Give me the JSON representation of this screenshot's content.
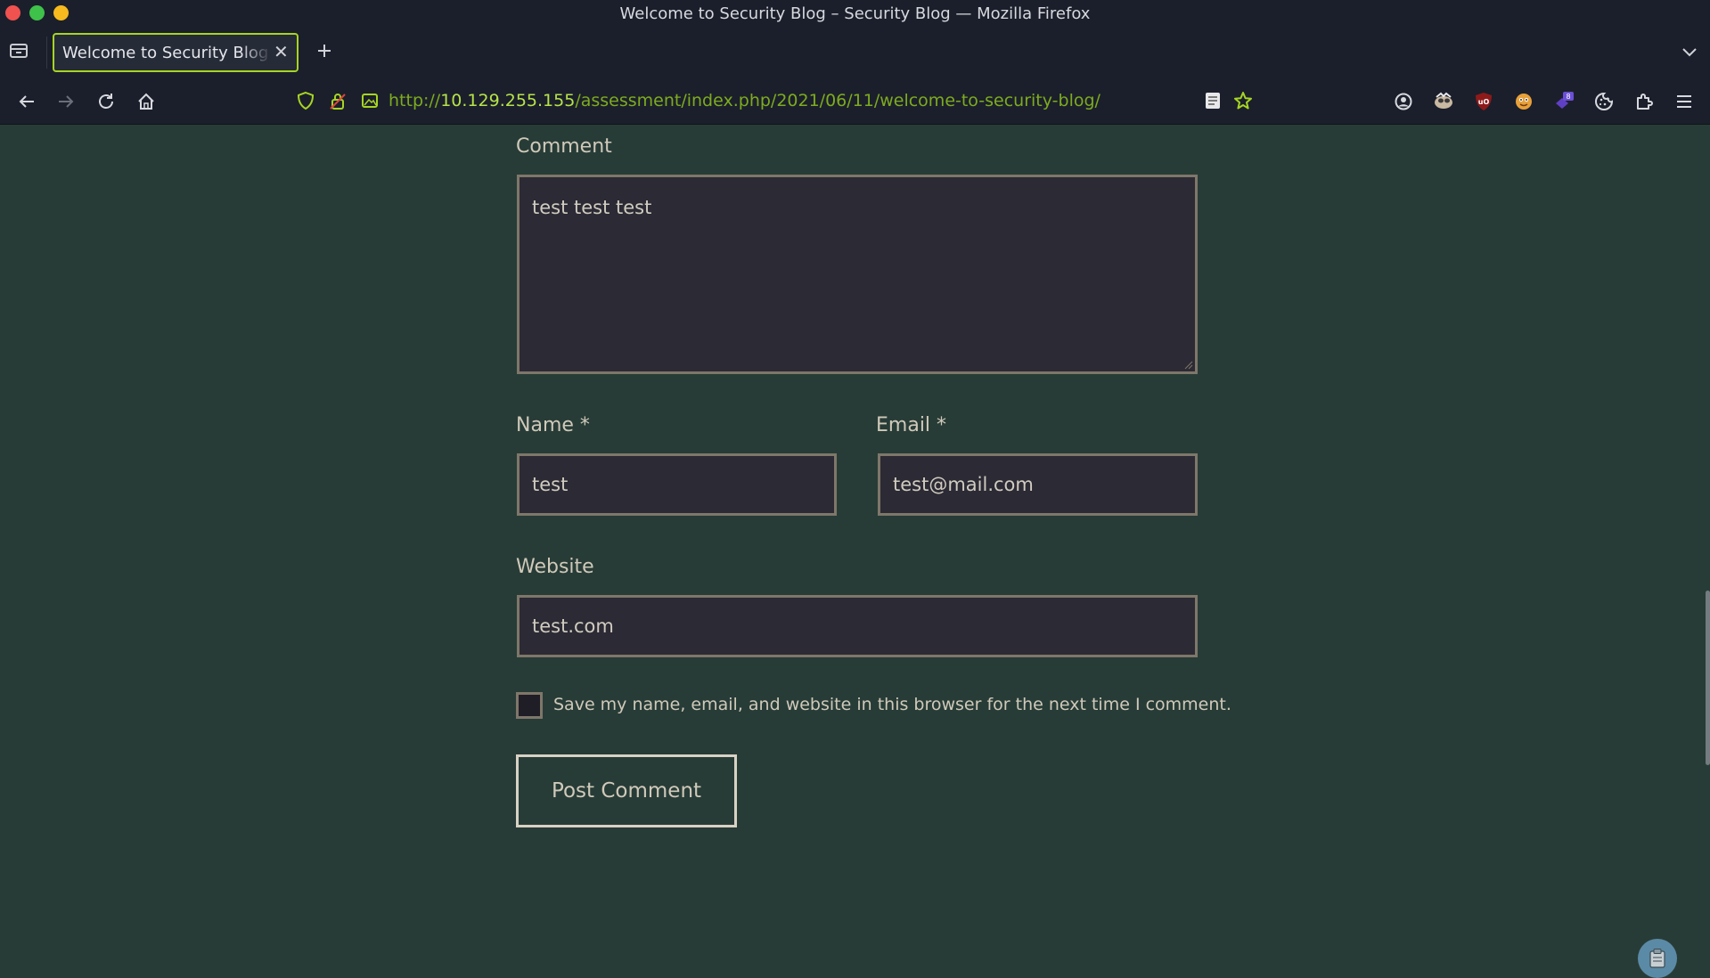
{
  "window": {
    "title": "Welcome to Security Blog – Security Blog — Mozilla Firefox"
  },
  "tabs": [
    {
      "title": "Welcome to Security Blog – Security Blog",
      "active": true
    }
  ],
  "url": {
    "scheme": "http://",
    "host": "10.129.255.155",
    "path": "/assessment/index.php/2021/06/11/welcome-to-security-blog/"
  },
  "toolbar": {
    "extensions": [
      "account-icon",
      "reader-icon",
      "ublock-icon",
      "extension-icon",
      "extension-badge-icon",
      "cookie-icon",
      "extensions-icon",
      "menu-icon"
    ],
    "badge_count": "8"
  },
  "form": {
    "comment_label": "Comment",
    "comment_value": "test test test",
    "name_label": "Name *",
    "name_value": "test",
    "email_label": "Email *",
    "email_value": "test@mail.com",
    "website_label": "Website",
    "website_value": "test.com",
    "save_label": "Save my name, email, and website in this browser for the next time I comment.",
    "save_checked": false,
    "submit_label": "Post Comment"
  },
  "colors": {
    "page_bg": "#283c37",
    "field_bg": "#2c2a34",
    "field_border": "#7e776a",
    "accent": "#a6d523",
    "chrome_bg": "#1b1f2b"
  }
}
